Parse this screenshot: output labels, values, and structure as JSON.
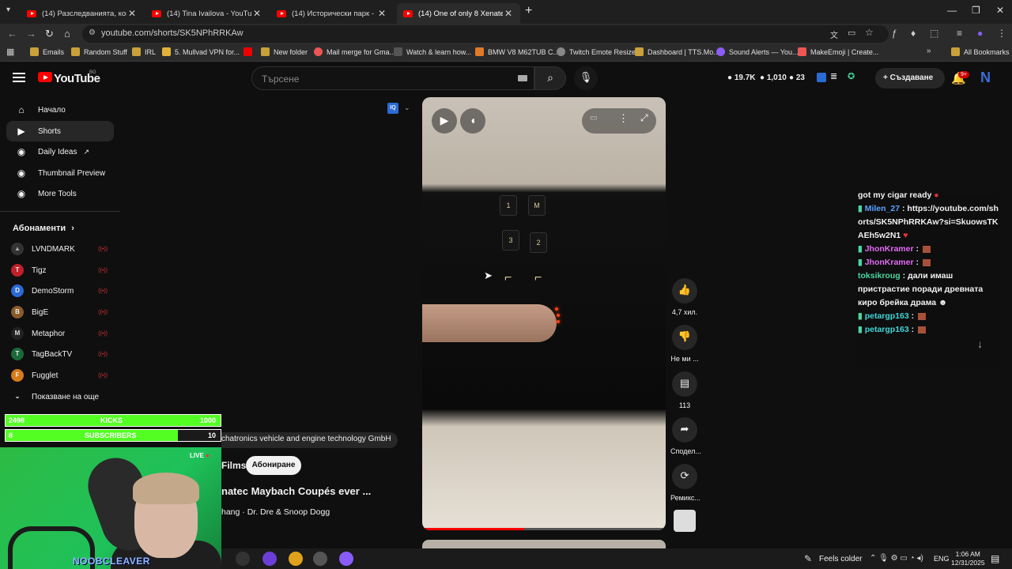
{
  "browser": {
    "tabs": [
      {
        "title": "(14) Разследванията, които бе"
      },
      {
        "title": "(14) Tina Ivailova - YouTube"
      },
      {
        "title": "(14) Исторически парк - Царс"
      },
      {
        "title": "(14) One of only 8 Xenatec May"
      }
    ],
    "url": "youtube.com/shorts/SK5NPhRRKAw",
    "bookmarks": [
      {
        "label": "Emails",
        "color": "#c9a03a"
      },
      {
        "label": "Random Stuff",
        "color": "#c9a03a"
      },
      {
        "label": "IRL",
        "color": "#c9a03a"
      },
      {
        "label": "5. Mullvad VPN for...",
        "color": "#e2b13a"
      },
      {
        "label": "",
        "color": "#e00"
      },
      {
        "label": "New folder",
        "color": "#c9a03a"
      },
      {
        "label": "Mail merge for Gma...",
        "color": "#e55"
      },
      {
        "label": "Watch & learn how...",
        "color": "#222"
      },
      {
        "label": "BMW V8 M62TUB C...",
        "color": "#e07a2a"
      },
      {
        "label": "Twitch Emote Resizer",
        "color": "#888"
      },
      {
        "label": "Dashboard | TTS.Mo...",
        "color": "#c9a03a"
      },
      {
        "label": "Sound Alerts — You...",
        "color": "#8b5cf6"
      },
      {
        "label": "MakeEmoji | Create...",
        "color": "#e55"
      }
    ],
    "all_bookmarks": "All Bookmarks"
  },
  "youtube": {
    "logo_text": "YouTube",
    "country": "BG",
    "search_placeholder": "Търсене",
    "stats": [
      "19.7K",
      "1,010",
      "23"
    ],
    "create_label": "Създаване",
    "notif_badge": "9+",
    "avatar_letter": "N"
  },
  "sidebar": {
    "items": [
      {
        "label": "Начало",
        "icon": "home-icon"
      },
      {
        "label": "Shorts",
        "icon": "shorts-icon"
      },
      {
        "label": "Daily Ideas",
        "icon": "idea-icon"
      },
      {
        "label": "Thumbnail Preview",
        "icon": "thumbnail-icon"
      },
      {
        "label": "More Tools",
        "icon": "tools-icon"
      }
    ],
    "subs_heading": "Абонаменти",
    "subs": [
      {
        "name": "LVNDMARK",
        "color": "#333"
      },
      {
        "name": "Tigz",
        "color": "#c0202a"
      },
      {
        "name": "DemoStorm",
        "color": "#2a6ad6"
      },
      {
        "name": "BigE",
        "color": "#8a5a2a"
      },
      {
        "name": "Metaphor",
        "color": "#222"
      },
      {
        "name": "TagBackTV",
        "color": "#1a6a3a"
      },
      {
        "name": "Fugglet",
        "color": "#d87a1a"
      }
    ],
    "show_more": "Показване на още"
  },
  "overlay": {
    "kicks": {
      "current": "2498",
      "label": "KICKS",
      "goal": "1000",
      "fill": 1.0
    },
    "subs": {
      "current": "8",
      "label": "SUBSCRIBERS",
      "goal": "10",
      "fill": 0.8
    },
    "cam_name": "NOOBCLEAVER",
    "live": "LIVE"
  },
  "short": {
    "credit": "chatronics vehicle and engine technology GmbH",
    "channel": "Films",
    "subscribe": "Абониране",
    "title": "natec Maybach Coupés ever ...",
    "music": "hang · Dr. Dre & Snoop Dogg",
    "progress": 0.42,
    "seat_buttons": [
      "1",
      "M",
      "3",
      "2"
    ],
    "actions": [
      {
        "icon": "like-icon",
        "label": "4,7 хил."
      },
      {
        "icon": "dislike-icon",
        "label": "Не ми ..."
      },
      {
        "icon": "comment-icon",
        "label": "113"
      },
      {
        "icon": "share-icon",
        "label": "Сподел..."
      },
      {
        "icon": "remix-icon",
        "label": "Ремикс..."
      }
    ]
  },
  "chat": {
    "messages": [
      {
        "user": "",
        "text": "got my cigar ready",
        "cls": "u0"
      },
      {
        "user": "Milen_27",
        "text": "https://youtube.com/shorts/SK5NPhRRKAw?si=SkuowsTKAEh5w2N1",
        "cls": "u1"
      },
      {
        "user": "JhonKramer",
        "text": "",
        "cls": "u2"
      },
      {
        "user": "JhonKramer",
        "text": "",
        "cls": "u2"
      },
      {
        "user": "toksikroug",
        "text": "дали имаш пристрастие поради древната киро брейка драма",
        "cls": "u3"
      },
      {
        "user": "petargp163",
        "text": "",
        "cls": "u4"
      },
      {
        "user": "petargp163",
        "text": "",
        "cls": "u4"
      }
    ]
  },
  "taskbar": {
    "weather": "Feels colder",
    "lang": "ENG",
    "time": "1:06 AM",
    "date": "12/31/2025"
  }
}
